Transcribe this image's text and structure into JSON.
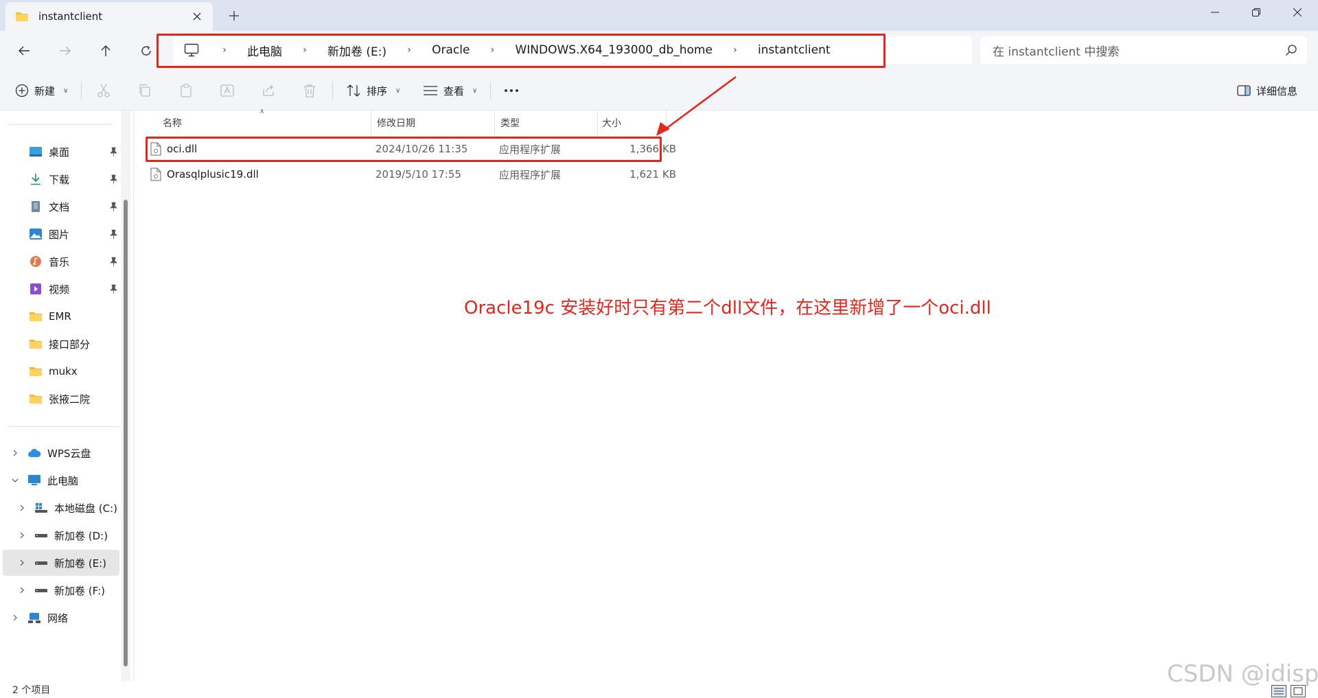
{
  "window": {
    "tab_title": "instantclient"
  },
  "address": {
    "crumbs": [
      "此电脑",
      "新加卷 (E:)",
      "Oracle",
      "WINDOWS.X64_193000_db_home",
      "instantclient"
    ],
    "search_placeholder": "在 instantclient 中搜索"
  },
  "toolbar": {
    "new_label": "新建",
    "sort_label": "排序",
    "view_label": "查看",
    "details_label": "详细信息"
  },
  "sidebar": {
    "quick_access": [
      {
        "label": "桌面",
        "icon": "desktop-icon",
        "pinned": true
      },
      {
        "label": "下载",
        "icon": "download-icon",
        "pinned": true
      },
      {
        "label": "文档",
        "icon": "document-icon",
        "pinned": true
      },
      {
        "label": "图片",
        "icon": "pictures-icon",
        "pinned": true
      },
      {
        "label": "音乐",
        "icon": "music-icon",
        "pinned": true
      },
      {
        "label": "视频",
        "icon": "video-icon",
        "pinned": true
      },
      {
        "label": "EMR",
        "icon": "folder-icon",
        "pinned": false
      },
      {
        "label": "接口部分",
        "icon": "folder-icon",
        "pinned": false
      },
      {
        "label": "mukx",
        "icon": "folder-icon",
        "pinned": false
      },
      {
        "label": "张掖二院",
        "icon": "folder-icon",
        "pinned": false
      }
    ],
    "tree": [
      {
        "label": "WPS云盘",
        "icon": "cloud-icon",
        "level": 0,
        "expanded": false
      },
      {
        "label": "此电脑",
        "icon": "computer-icon",
        "level": 0,
        "expanded": true
      },
      {
        "label": "本地磁盘 (C:)",
        "icon": "system-drive-icon",
        "level": 1,
        "expanded": false
      },
      {
        "label": "新加卷 (D:)",
        "icon": "drive-icon",
        "level": 1,
        "expanded": false
      },
      {
        "label": "新加卷 (E:)",
        "icon": "drive-icon",
        "level": 1,
        "expanded": false,
        "selected": true
      },
      {
        "label": "新加卷 (F:)",
        "icon": "drive-icon",
        "level": 1,
        "expanded": false
      },
      {
        "label": "网络",
        "icon": "network-icon",
        "level": 0,
        "expanded": false
      }
    ]
  },
  "columns": {
    "name": "名称",
    "modified": "修改日期",
    "type": "类型",
    "size": "大小"
  },
  "files": [
    {
      "name": "oci.dll",
      "modified": "2024/10/26 11:35",
      "type": "应用程序扩展",
      "size": "1,366 KB"
    },
    {
      "name": "Orasqlplusic19.dll",
      "modified": "2019/5/10 17:55",
      "type": "应用程序扩展",
      "size": "1,621 KB"
    }
  ],
  "annotation": "Oracle19c 安装好时只有第二个dll文件，在这里新增了一个oci.dll",
  "status": {
    "item_count": "2 个项目"
  },
  "watermark": "CSDN @idisp",
  "colors": {
    "highlight": "#e1261c",
    "chrome": "#f3f5f8",
    "tabbar": "#dbe4f0"
  }
}
